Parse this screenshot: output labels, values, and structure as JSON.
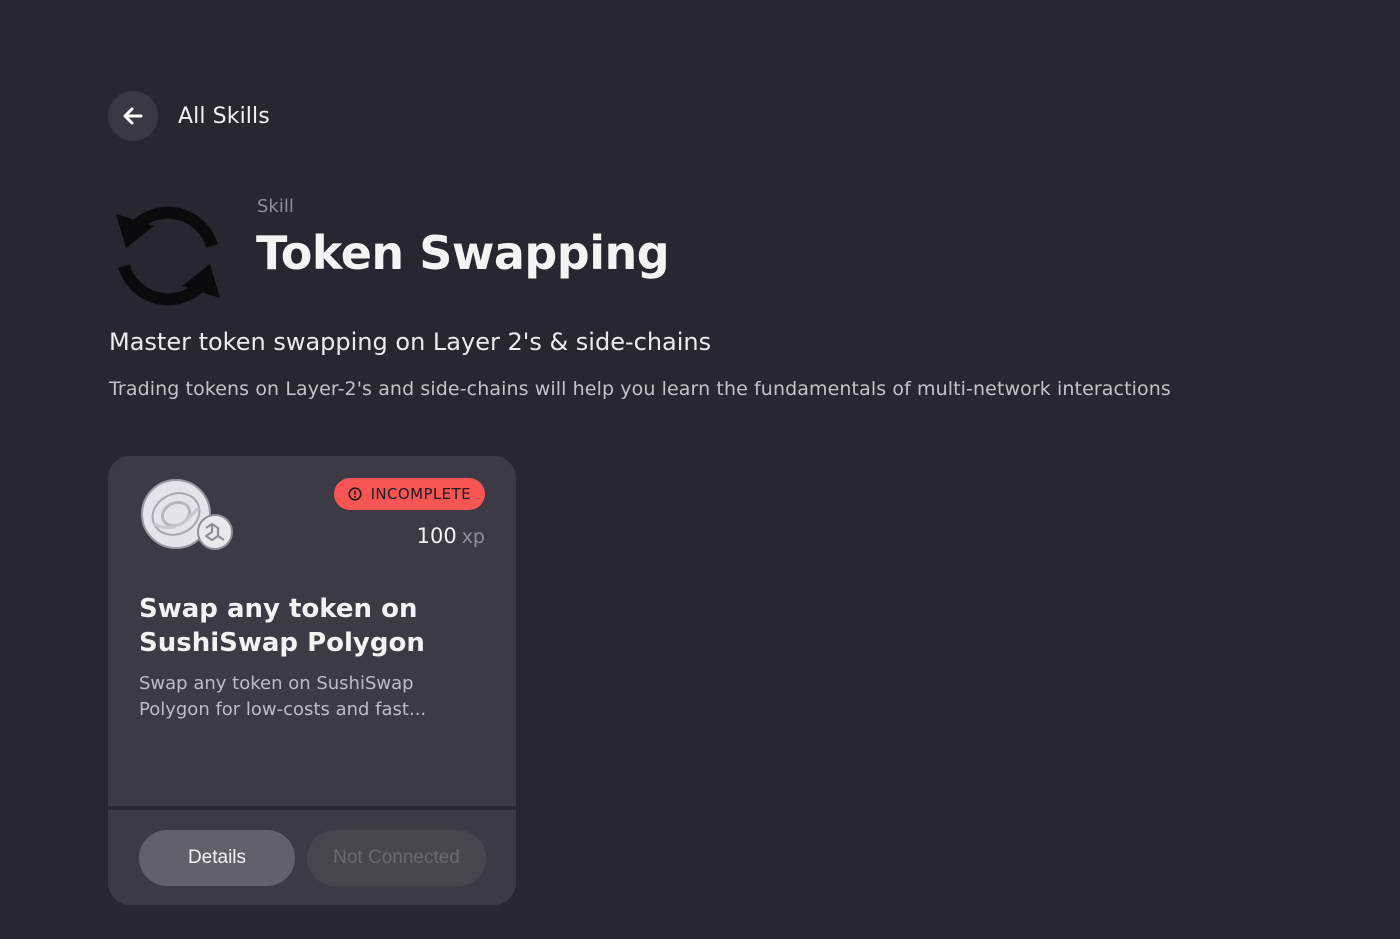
{
  "nav": {
    "back_label": "All Skills",
    "back_icon": "arrow-left-icon"
  },
  "skill": {
    "kicker": "Skill",
    "title": "Token Swapping",
    "icon": "refresh-cycle-icon",
    "subtitle": "Master token swapping on Layer 2's & side-chains",
    "description": "Trading tokens on Layer-2's and side-chains will help you learn the fundamentals of multi-network interactions"
  },
  "quest_card": {
    "image": "sushiswap-polygon-logo",
    "status_icon": "alert-circle-icon",
    "status": "INCOMPLETE",
    "status_color": "#f75454",
    "xp_value": "100",
    "xp_unit": "xp",
    "title": "Swap any token on SushiSwap Polygon",
    "description": "Swap any token on SushiSwap Polygon for low-costs and fast...",
    "details_label": "Details",
    "connect_label": "Not Connected"
  }
}
